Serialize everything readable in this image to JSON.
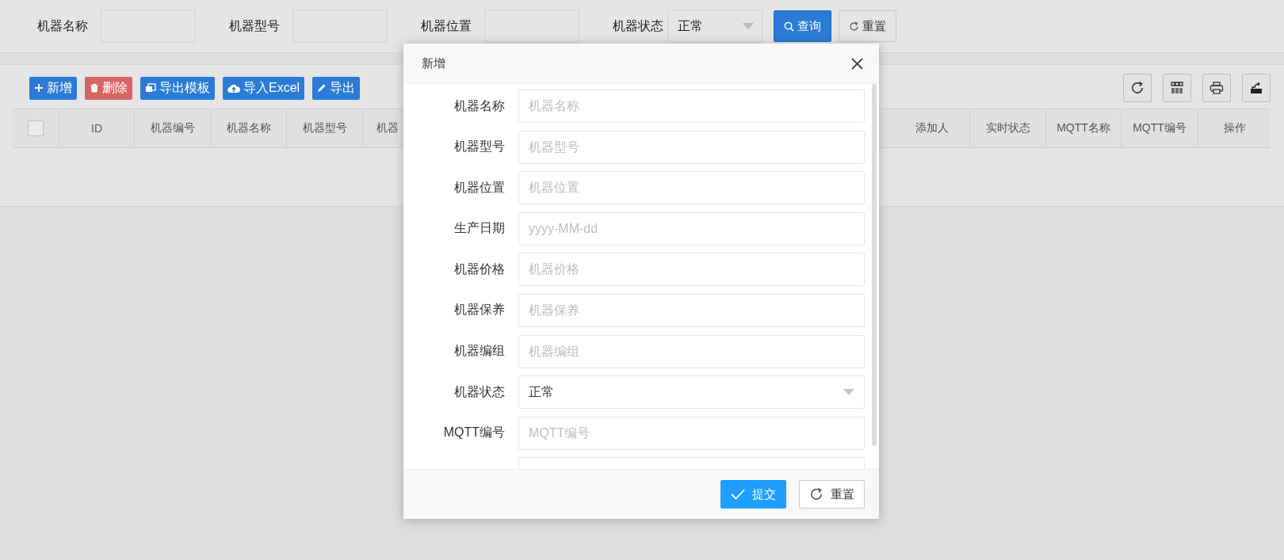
{
  "search": {
    "fields": [
      {
        "label": "机器名称",
        "kind": "input"
      },
      {
        "label": "机器型号",
        "kind": "input"
      },
      {
        "label": "机器位置",
        "kind": "input"
      },
      {
        "label": "机器状态",
        "kind": "select",
        "value": "正常"
      }
    ],
    "buttons": [
      {
        "label": "查询",
        "kind": "query"
      },
      {
        "label": "重置",
        "kind": "reset"
      }
    ]
  },
  "toolbar": {
    "buttons": [
      {
        "label": "新增",
        "kind": "add"
      },
      {
        "label": "删除",
        "kind": "delete"
      },
      {
        "label": "导出模板",
        "kind": "template"
      },
      {
        "label": "导入Excel",
        "kind": "import"
      },
      {
        "label": "导出",
        "kind": "export"
      }
    ]
  },
  "table": {
    "header_checkbox": {
      "checked": false
    },
    "columns_left": [
      "ID",
      "机器编号",
      "机器名称",
      "机器型号",
      "机器"
    ],
    "columns_right": [
      "添加人",
      "实时状态",
      "MQTT名称",
      "MQTT编号",
      "操作"
    ]
  },
  "dialog": {
    "title": "新增",
    "fields": [
      {
        "label": "机器名称",
        "kind": "text",
        "placeholder": "机器名称"
      },
      {
        "label": "机器型号",
        "kind": "text",
        "placeholder": "机器型号"
      },
      {
        "label": "机器位置",
        "kind": "text",
        "placeholder": "机器位置"
      },
      {
        "label": "生产日期",
        "kind": "text",
        "placeholder": "yyyy-MM-dd"
      },
      {
        "label": "机器价格",
        "kind": "text",
        "placeholder": "机器价格"
      },
      {
        "label": "机器保养",
        "kind": "text",
        "placeholder": "机器保养"
      },
      {
        "label": "机器编组",
        "kind": "text",
        "placeholder": "机器编组"
      },
      {
        "label": "机器状态",
        "kind": "select",
        "value": "正常"
      },
      {
        "label": "MQTT编号",
        "kind": "text",
        "placeholder": "MQTT编号"
      }
    ],
    "buttons": [
      {
        "label": "提交",
        "kind": "submit"
      },
      {
        "label": "重置",
        "kind": "reset"
      }
    ]
  }
}
